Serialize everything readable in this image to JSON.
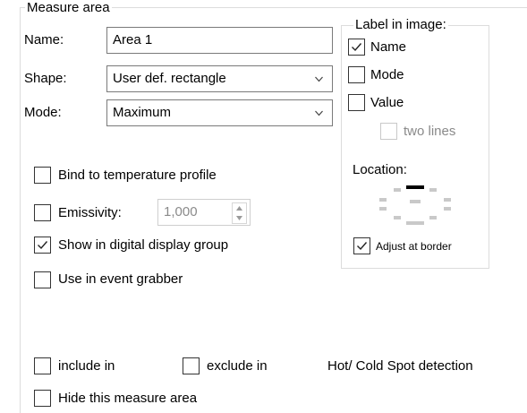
{
  "measure_area": {
    "legend": "Measure area",
    "name_label": "Name:",
    "name_value": "Area 1",
    "shape_label": "Shape:",
    "shape_value": "User def. rectangle",
    "mode_label": "Mode:",
    "mode_value": "Maximum"
  },
  "label_in_image": {
    "legend": "Label in image:",
    "name": {
      "label": "Name",
      "checked": true
    },
    "mode": {
      "label": "Mode",
      "checked": false
    },
    "value": {
      "label": "Value",
      "checked": false
    },
    "two_lines": {
      "label": "two lines",
      "checked": false,
      "disabled": true
    },
    "location_label": "Location:",
    "adjust_at_border": {
      "label": "Adjust at border",
      "checked": true
    }
  },
  "options": {
    "bind_profile": {
      "label": "Bind to temperature profile",
      "checked": false
    },
    "emissivity": {
      "label": "Emissivity:",
      "checked": false,
      "value": "1,000"
    },
    "show_digital": {
      "label": "Show in digital display group",
      "checked": true
    },
    "event_grabber": {
      "label": "Use in event grabber",
      "checked": false
    },
    "include_in": {
      "label": "include in",
      "checked": false
    },
    "exclude_in": {
      "label": "exclude in",
      "checked": false
    },
    "hotcold_text": "Hot/ Cold Spot detection",
    "hide_area": {
      "label": "Hide this measure area",
      "checked": false
    }
  },
  "icons": {
    "check": "checkmark-icon",
    "dropdown": "chevron-down-icon",
    "spin_up": "spin-up-icon",
    "spin_down": "spin-down-icon"
  }
}
